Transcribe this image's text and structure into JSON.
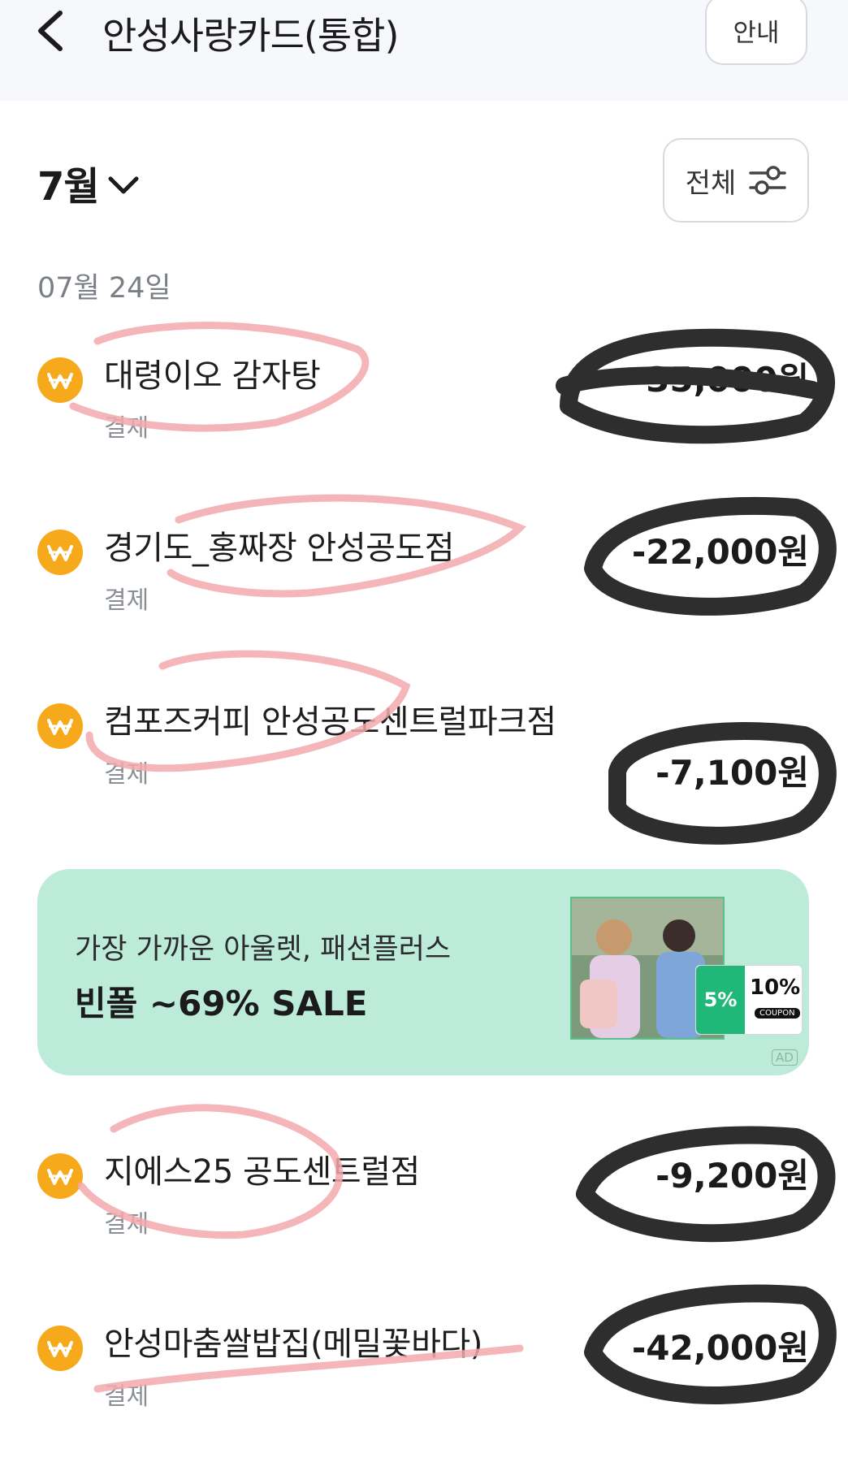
{
  "header": {
    "title": "안성사랑카드(통합)",
    "info_label": "안내"
  },
  "filter_bar": {
    "month": "7월",
    "filter_label": "전체"
  },
  "date_group": "07월 24일",
  "transactions": [
    {
      "name": "대령이오 감자탕",
      "type": "결제",
      "amount": "-35,000원"
    },
    {
      "name": "경기도_홍짜장 안성공도점",
      "type": "결제",
      "amount": "-22,000원"
    },
    {
      "name": "컴포즈커피 안성공도센트럴파크점",
      "type": "결제",
      "amount": "-7,100원"
    },
    {
      "name": "지에스25 공도센트럴점",
      "type": "결제",
      "amount": "-9,200원"
    },
    {
      "name": "안성마춤쌀밥집(메밀꽃바다)",
      "type": "결제",
      "amount": "-42,000원"
    }
  ],
  "ad": {
    "subtitle": "가장 가까운 아울렛, 패션플러스",
    "headline": "빈폴 ~69% SALE",
    "badge_left": "5%",
    "badge_right": "10%",
    "badge_tag": "COUPON",
    "ad_mark": "AD"
  },
  "colors": {
    "accent": "#f7a91c",
    "ad_background": "#bdebd9",
    "header_background": "#f6f8fb"
  },
  "icons": [
    "chevron-left-icon",
    "chevron-down-icon",
    "sliders-icon",
    "won-coin-icon"
  ]
}
